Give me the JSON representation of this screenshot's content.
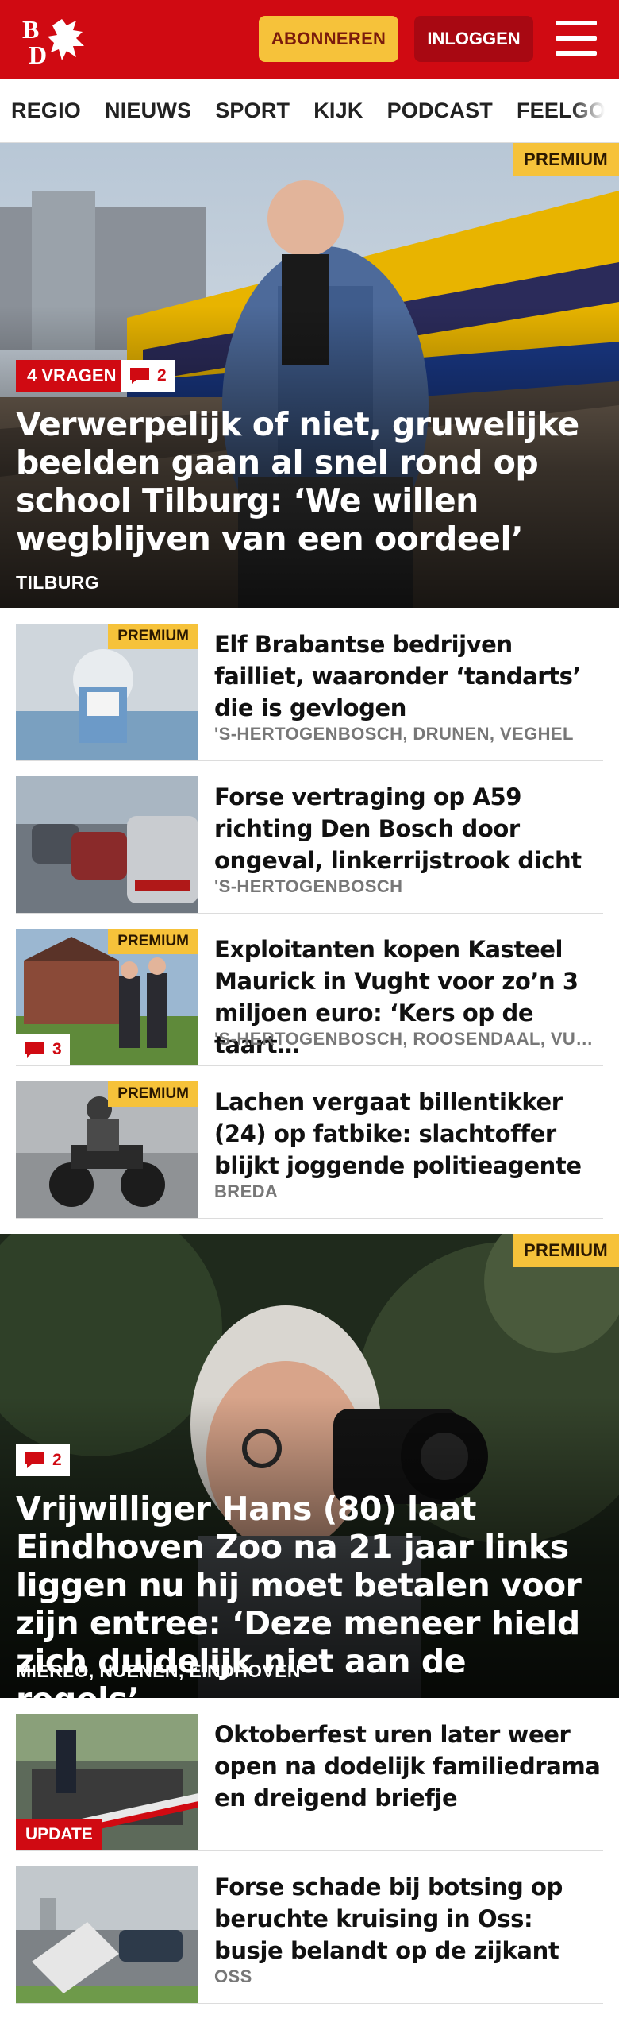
{
  "header": {
    "logo_text": "BD",
    "subscribe_label": "ABONNEREN",
    "login_label": "INLOGGEN",
    "menu_icon": "hamburger-menu-icon",
    "colors": {
      "brand_red": "#d00a12",
      "accent_yellow": "#f6c23a",
      "login_dark_red": "#a80812"
    }
  },
  "nav": {
    "items": [
      "REGIO",
      "NIEUWS",
      "SPORT",
      "KIJK",
      "PODCAST",
      "FEELGOOD"
    ]
  },
  "hero1": {
    "premium_label": "PREMIUM",
    "tag": "4 VRAGEN",
    "comments": "2",
    "title": "Verwerpelijk of niet, gruwelijke beelden gaan al snel rond op school Tilburg: ‘We willen wegblijven van een oordeel’",
    "location": "TILBURG"
  },
  "list1": [
    {
      "title": "Elf Brabantse bedrijven failliet, waaronder ‘tandarts’ die is gevlogen",
      "location": "'S-HERTOGENBOSCH, DRUNEN, VEGHEL",
      "premium_label": "PREMIUM"
    },
    {
      "title": "Forse vertraging op A59 richting Den Bosch door ongeval, linkerrijstrook dicht",
      "location": "'S-HERTOGENBOSCH"
    },
    {
      "title": "Exploitanten kopen Kasteel Maurick in Vught voor zo’n 3 miljoen euro: ‘Kers op de taart…",
      "location": "'S-HERTOGENBOSCH, ROOSENDAAL, VUGHT",
      "premium_label": "PREMIUM",
      "comments": "3"
    },
    {
      "title": "Lachen vergaat billentikker (24) op fatbike: slachtoffer blijkt joggende politieagente",
      "location": "BREDA",
      "premium_label": "PREMIUM"
    }
  ],
  "hero2": {
    "premium_label": "PREMIUM",
    "comments": "2",
    "title": "Vrijwilliger Hans (80) laat Eindhoven Zoo na 21 jaar links liggen nu hij moet betalen voor zijn entree: ‘Deze meneer hield zich duidelijk niet aan de regels’",
    "location": "MIERLO, NUENEN, EINDHOVEN"
  },
  "list2": [
    {
      "title": "Oktoberfest uren later weer open na dodelijk familiedrama en dreigend briefje",
      "update_label": "UPDATE"
    },
    {
      "title": "Forse schade bij botsing op beruchte kruising in Oss: busje belandt op de zijkant",
      "location": "OSS"
    }
  ]
}
